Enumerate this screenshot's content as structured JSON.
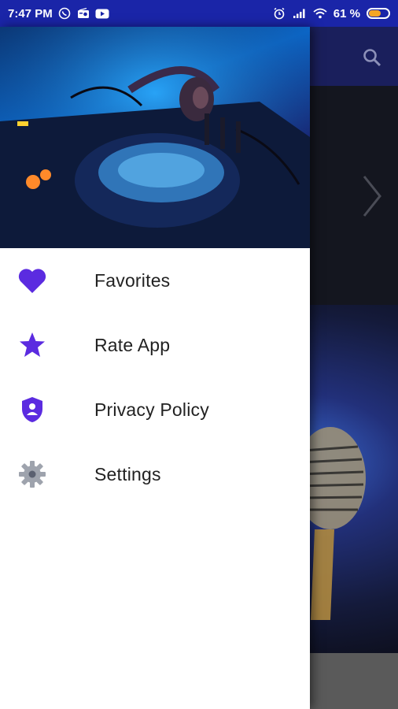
{
  "status_bar": {
    "time": "7:47 PM",
    "battery_text": "61 %",
    "battery_level": 0.61,
    "icons_left": [
      "whatsapp-icon",
      "radio-icon",
      "youtube-icon"
    ],
    "icons_right": [
      "alarm-icon",
      "signal-icon",
      "wifi-icon",
      "battery-icon"
    ]
  },
  "colors": {
    "status_bar": "#1a25a8",
    "accent": "#5b2be0",
    "drawer_bg": "#ffffff",
    "label": "#222222"
  },
  "drawer": {
    "header_image": "dj-mixer-headphones-image",
    "items": [
      {
        "label": "Favorites",
        "icon": "heart-icon"
      },
      {
        "label": "Rate App",
        "icon": "star-icon"
      },
      {
        "label": "Privacy Policy",
        "icon": "shield-user-icon"
      },
      {
        "label": "Settings",
        "icon": "gear-icon"
      }
    ]
  },
  "background_app": {
    "toolbar_icon": "search-icon",
    "slider_icon": "chevron-right-icon",
    "poster_image": "microphone-image"
  }
}
